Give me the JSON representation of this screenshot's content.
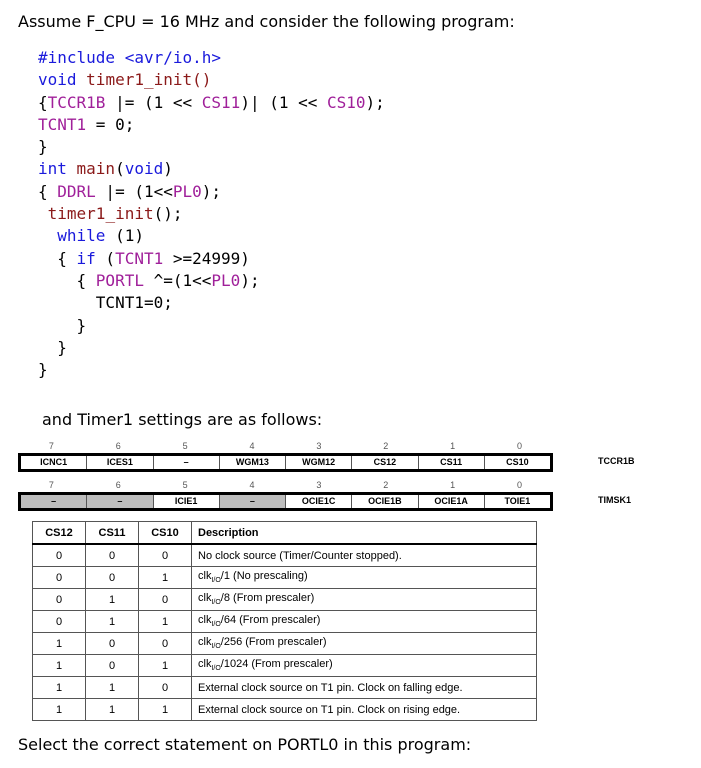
{
  "intro": "Assume F_CPU = 16 MHz and consider the following program:",
  "code_lines": [
    [
      [
        "#include ",
        "kw"
      ],
      [
        "<avr/io.h>",
        "kw"
      ]
    ],
    [
      [
        "void ",
        "kw"
      ],
      [
        "timer1_init",
        "fn"
      ],
      [
        "()",
        "fn"
      ]
    ],
    [
      [
        "{",
        "pl"
      ],
      [
        "TCCR1B ",
        "mac"
      ],
      [
        "|= (1 << ",
        "pl"
      ],
      [
        "CS11",
        "mac"
      ],
      [
        ")| (1 << ",
        "pl"
      ],
      [
        "CS10",
        "mac"
      ],
      [
        ");",
        "pl"
      ]
    ],
    [
      [
        "TCNT1",
        "mac"
      ],
      [
        " = 0;",
        "pl"
      ]
    ],
    [
      [
        "}",
        "pl"
      ]
    ],
    [
      [
        "int ",
        "kw"
      ],
      [
        "main",
        "fn"
      ],
      [
        "(",
        "pl"
      ],
      [
        "void",
        "kw"
      ],
      [
        ")",
        "pl"
      ]
    ],
    [
      [
        "{ ",
        "pl"
      ],
      [
        "DDRL",
        "mac"
      ],
      [
        " |= (1<<",
        "pl"
      ],
      [
        "PL0",
        "mac"
      ],
      [
        ");",
        "pl"
      ]
    ],
    [
      [
        " ",
        "pl"
      ],
      [
        "timer1_init",
        "fn"
      ],
      [
        "();",
        "pl"
      ]
    ],
    [
      [
        "  ",
        "pl"
      ],
      [
        "while",
        "kw"
      ],
      [
        " (1)",
        "pl"
      ]
    ],
    [
      [
        "  { ",
        "pl"
      ],
      [
        "if",
        "kw"
      ],
      [
        " (",
        "pl"
      ],
      [
        "TCNT1",
        "mac"
      ],
      [
        " >=24999)",
        "pl"
      ]
    ],
    [
      [
        "    { ",
        "pl"
      ],
      [
        "PORTL",
        "mac"
      ],
      [
        " ^=(1<<",
        "pl"
      ],
      [
        "PL0",
        "mac"
      ],
      [
        ");",
        "pl"
      ]
    ],
    [
      [
        "      TCNT1=0;",
        "pl"
      ]
    ],
    [
      [
        "    }",
        "pl"
      ]
    ],
    [
      [
        "  }",
        "pl"
      ]
    ],
    [
      [
        "}",
        "pl"
      ]
    ]
  ],
  "settings_intro": "and Timer1 settings are as follows:",
  "registers": [
    {
      "name": "TCCR1B",
      "bits": [
        "7",
        "6",
        "5",
        "4",
        "3",
        "2",
        "1",
        "0"
      ],
      "fields": [
        "ICNC1",
        "ICES1",
        "–",
        "WGM13",
        "WGM12",
        "CS12",
        "CS11",
        "CS10"
      ],
      "reserved": [
        false,
        false,
        false,
        false,
        false,
        false,
        false,
        false
      ]
    },
    {
      "name": "TIMSK1",
      "bits": [
        "7",
        "6",
        "5",
        "4",
        "3",
        "2",
        "1",
        "0"
      ],
      "fields": [
        "–",
        "–",
        "ICIE1",
        "–",
        "OCIE1C",
        "OCIE1B",
        "OCIE1A",
        "TOIE1"
      ],
      "reserved": [
        true,
        true,
        false,
        true,
        false,
        false,
        false,
        false
      ]
    }
  ],
  "table": {
    "headers": [
      "CS12",
      "CS11",
      "CS10",
      "Description"
    ],
    "rows": [
      {
        "v": [
          "0",
          "0",
          "0"
        ],
        "pre": "",
        "sub": "",
        "desc": "No clock source (Timer/Counter stopped)."
      },
      {
        "v": [
          "0",
          "0",
          "1"
        ],
        "pre": "clk",
        "sub": "I/O",
        "desc": "/1 (No prescaling)"
      },
      {
        "v": [
          "0",
          "1",
          "0"
        ],
        "pre": "clk",
        "sub": "I/O",
        "desc": "/8 (From prescaler)"
      },
      {
        "v": [
          "0",
          "1",
          "1"
        ],
        "pre": "clk",
        "sub": "I/O",
        "desc": "/64 (From prescaler)"
      },
      {
        "v": [
          "1",
          "0",
          "0"
        ],
        "pre": "clk",
        "sub": "I/O",
        "desc": "/256 (From prescaler)"
      },
      {
        "v": [
          "1",
          "0",
          "1"
        ],
        "pre": "clk",
        "sub": "I/O",
        "desc": "/1024 (From prescaler)"
      },
      {
        "v": [
          "1",
          "1",
          "0"
        ],
        "pre": "",
        "sub": "",
        "desc": "External clock source on T1 pin. Clock on falling edge."
      },
      {
        "v": [
          "1",
          "1",
          "1"
        ],
        "pre": "",
        "sub": "",
        "desc": "External clock source on T1 pin. Clock on rising edge."
      }
    ]
  },
  "question": "Select the correct statement on PORTL0 in this program:"
}
